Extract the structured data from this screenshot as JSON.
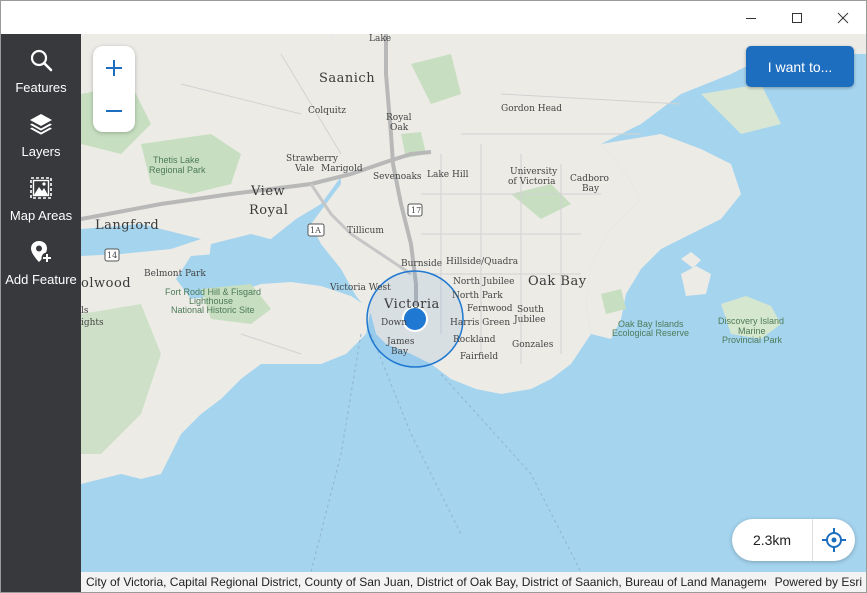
{
  "window": {
    "controls": {
      "minimize": "minimize-icon",
      "maximize": "maximize-icon",
      "close": "close-icon"
    }
  },
  "sidebar": {
    "items": [
      {
        "label": "Features",
        "icon": "search-icon"
      },
      {
        "label": "Layers",
        "icon": "layers-icon"
      },
      {
        "label": "Map Areas",
        "icon": "map-areas-icon"
      },
      {
        "label": "Add Feature",
        "icon": "add-feature-icon"
      }
    ]
  },
  "map": {
    "zoom_in": "+",
    "zoom_out": "−",
    "i_want_to_label": "I want to...",
    "scale_label": "2.3km",
    "labels": {
      "lake": "Lake",
      "saanich": "Saanich",
      "colquitz": "Colquitz",
      "royal_oak_1": "Royal",
      "royal_oak_2": "Oak",
      "gordon_head": "Gordon Head",
      "thetis_1": "Thetis Lake",
      "thetis_2": "Regional Park",
      "strawberry_1": "Strawberry",
      "strawberry_2": "Vale",
      "marigold": "Marigold",
      "sevenoaks": "Sevenoaks",
      "lake_hill": "Lake Hill",
      "uvic_1": "University",
      "uvic_2": "of Victoria",
      "cadboro_1": "Cadboro",
      "cadboro_2": "Bay",
      "view_royal_1": "View",
      "view_royal_2": "Royal",
      "langford": "Langford",
      "tillicum": "Tillicum",
      "burnside": "Burnside",
      "hillside": "Hillside/Quadra",
      "belmont": "Belmont Park",
      "colwood": "olwood",
      "fort_rodd_1": "Fort Rodd Hill & Fisgard",
      "fort_rodd_2": "Lighthouse",
      "fort_rodd_3": "National Historic Site",
      "victoria_west": "Victoria West",
      "north_jubilee": "North Jubilee",
      "oak_bay": "Oak Bay",
      "north_park": "North Park",
      "victoria": "Victoria",
      "fernwood": "Fernwood",
      "south_jubilee_1": "South",
      "south_jubilee_2": "Jubilee",
      "downtown": "Down",
      "harris_green": "Harris Green",
      "james_bay_1": "James",
      "james_bay_2": "Bay",
      "rockland": "Rockland",
      "gonzales": "Gonzales",
      "fairfield": "Fairfield",
      "oak_bay_islands_1": "Oak Bay Islands",
      "oak_bay_islands_2": "Ecological Reserve",
      "discovery_1": "Discovery Island",
      "discovery_2": "Marine",
      "discovery_3": "Provincial Park",
      "hwy_17": "17",
      "hwy_1a": "1A",
      "hwy_14": "14",
      "ights": "ights",
      "ls": "ls"
    }
  },
  "attribution": {
    "text": "City of Victoria, Capital Regional District, County of San Juan, District of Oak Bay, District of Saanich, Bureau of Land Manageme...",
    "powered_by": "Powered by Esri"
  },
  "colors": {
    "sidebar": "#37393c",
    "accent": "#1e6ebf",
    "water": "#a5d4ef",
    "land": "#ecebe6",
    "park": "#c7dfc0",
    "location": "#1f78d1"
  }
}
